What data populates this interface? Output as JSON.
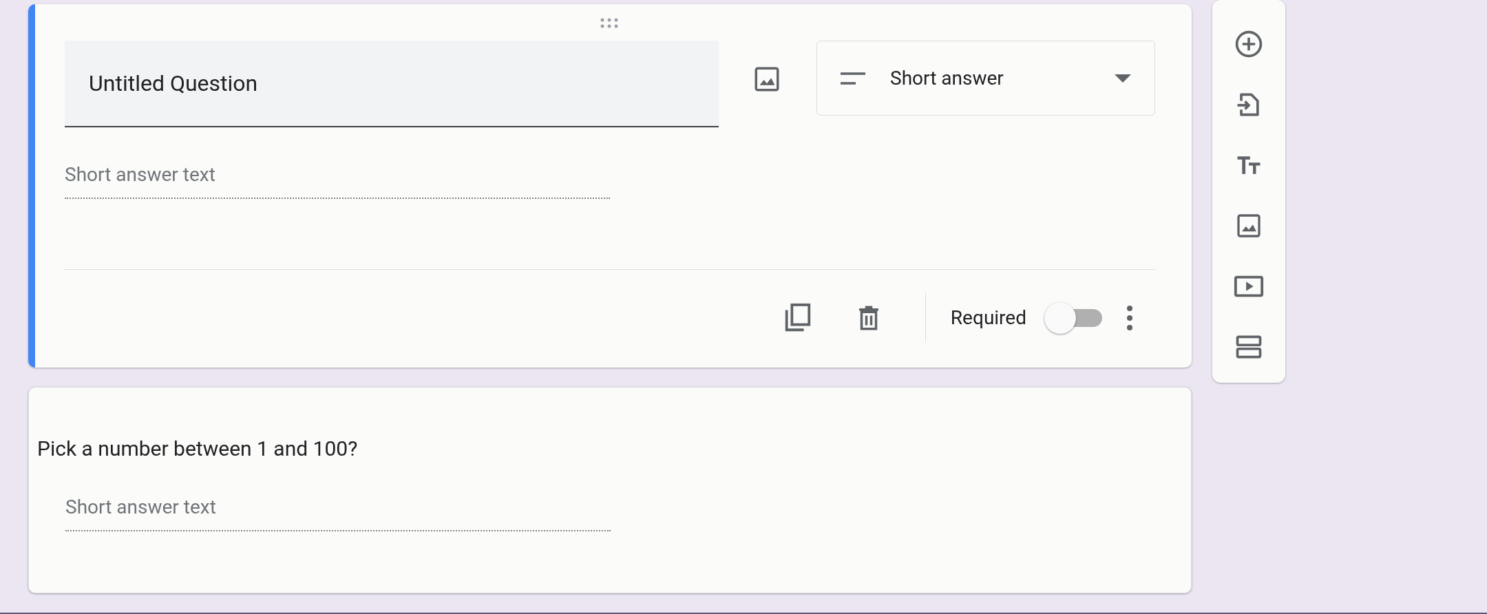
{
  "questions": [
    {
      "kind": "editing",
      "selected": true,
      "title": "Untitled Question",
      "type_label": "Short answer",
      "answer_placeholder": "Short answer text",
      "required_label": "Required",
      "required": false
    },
    {
      "kind": "preview",
      "selected": false,
      "title": "Pick a number between 1 and 100?",
      "answer_placeholder": "Short answer text"
    }
  ]
}
